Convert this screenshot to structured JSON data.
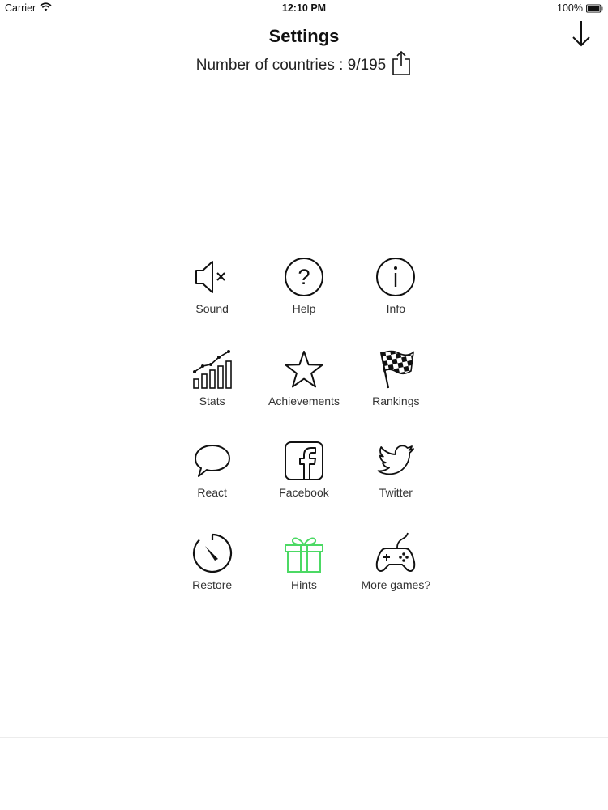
{
  "status_bar": {
    "carrier": "Carrier",
    "time": "12:10 PM",
    "battery": "100%"
  },
  "header": {
    "title": "Settings",
    "subtitle": "Number of countries : 9/195"
  },
  "colors": {
    "text": "#111111",
    "label": "#333333",
    "accent_green": "#4cd964"
  },
  "menu": {
    "items": [
      {
        "label": "Sound",
        "icon": "speaker-muted-icon"
      },
      {
        "label": "Help",
        "icon": "question-circle-icon"
      },
      {
        "label": "Info",
        "icon": "info-circle-icon"
      },
      {
        "label": "Stats",
        "icon": "bar-chart-icon"
      },
      {
        "label": "Achievements",
        "icon": "star-icon"
      },
      {
        "label": "Rankings",
        "icon": "checkered-flag-icon"
      },
      {
        "label": "React",
        "icon": "speech-bubble-icon"
      },
      {
        "label": "Facebook",
        "icon": "facebook-icon"
      },
      {
        "label": "Twitter",
        "icon": "twitter-bird-icon"
      },
      {
        "label": "Restore",
        "icon": "timer-icon"
      },
      {
        "label": "Hints",
        "icon": "gift-icon"
      },
      {
        "label": "More games?",
        "icon": "gamepad-icon"
      }
    ]
  }
}
